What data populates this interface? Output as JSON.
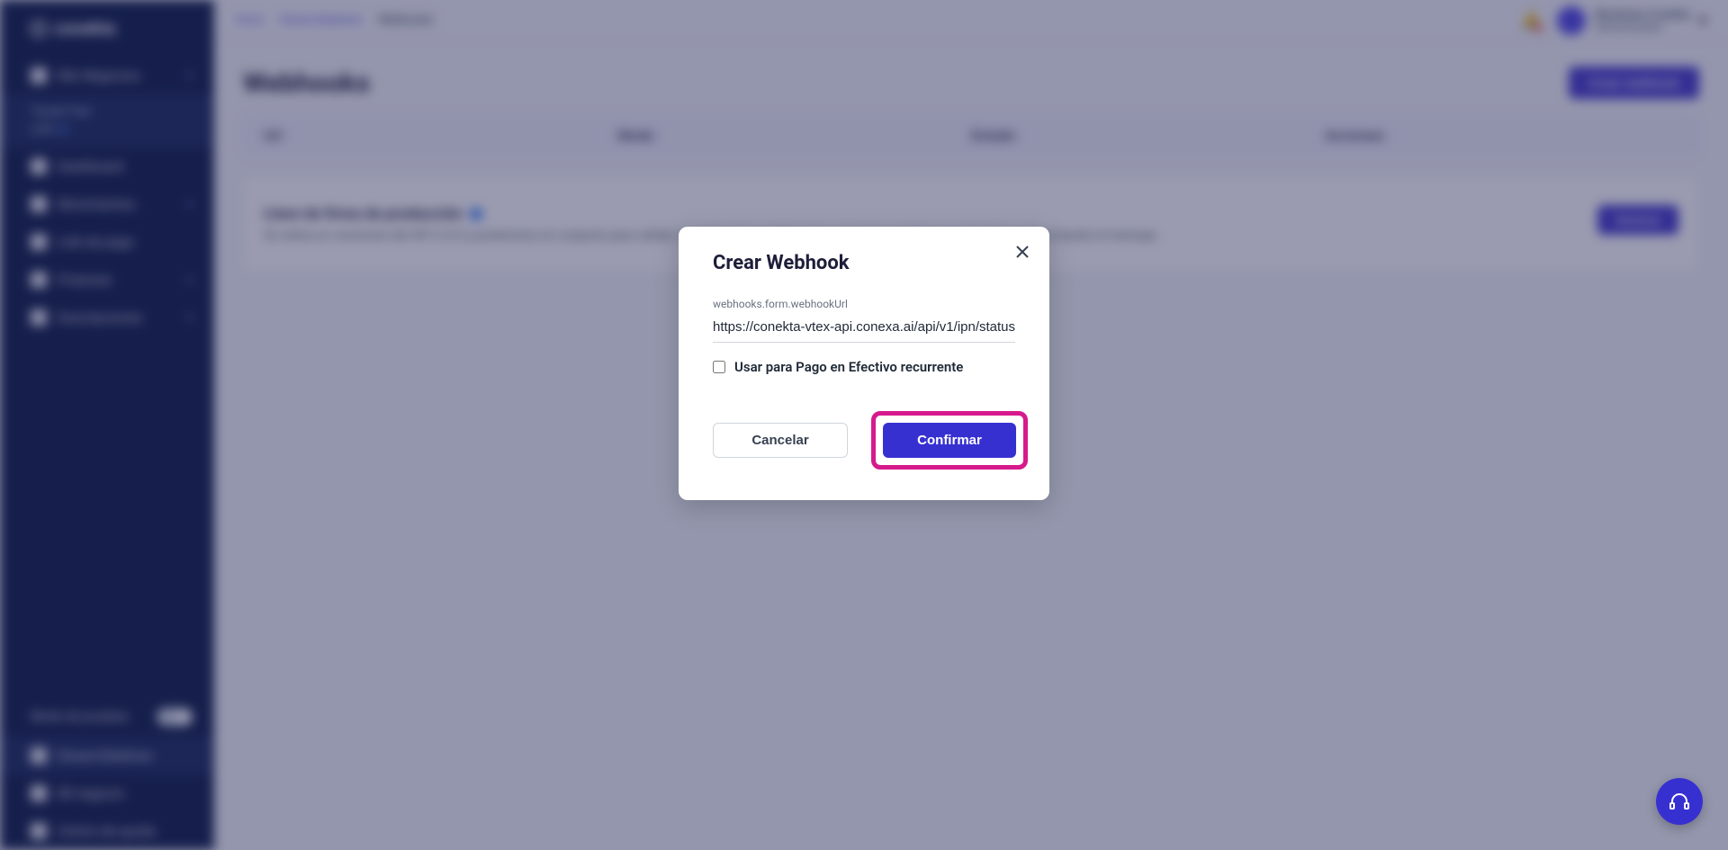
{
  "brand": "conekta",
  "sidebar": {
    "items": [
      {
        "label": "Mis Negocios"
      }
    ],
    "active_company": {
      "name": "Tienda Test",
      "status": "LIVE"
    },
    "nav": [
      {
        "label": "Dashboard"
      },
      {
        "label": "Movimientos"
      },
      {
        "label": "Link de pago"
      },
      {
        "label": "Finanzas"
      },
      {
        "label": "Suscripciones"
      }
    ],
    "test_mode_label": "Modo de pruebas",
    "bottom": [
      {
        "label": "Desarrolladores"
      },
      {
        "label": "Mi negocio"
      },
      {
        "label": "Centro de ayuda"
      }
    ]
  },
  "breadcrumbs": [
    "Inicio",
    "Desarrolladores",
    "Webhooks"
  ],
  "user": {
    "name": "Blockstore Conekta",
    "role": "Administrador"
  },
  "page": {
    "title": "Webhooks",
    "create_btn": "Crear webhook",
    "columns": [
      "Url",
      "Modo",
      "Estado",
      "Acciones"
    ],
    "signature_title": "Llave de firma de producción",
    "signature_desc": "Se utiliza en versiones del API 2.0.0 y posteriores en conjunto para validar el evento de la notificación webhook y verificar que Conekta está enviando el mensaje.",
    "generate_btn": "Generar"
  },
  "modal": {
    "title": "Crear Webhook",
    "url_label": "webhooks.form.webhookUrl",
    "url_value": "https://conekta-vtex-api.conexa.ai/api/v1/ipn/status",
    "checkbox_label": "Usar para Pago en Efectivo recurrente",
    "cancel": "Cancelar",
    "confirm": "Confirmar"
  }
}
